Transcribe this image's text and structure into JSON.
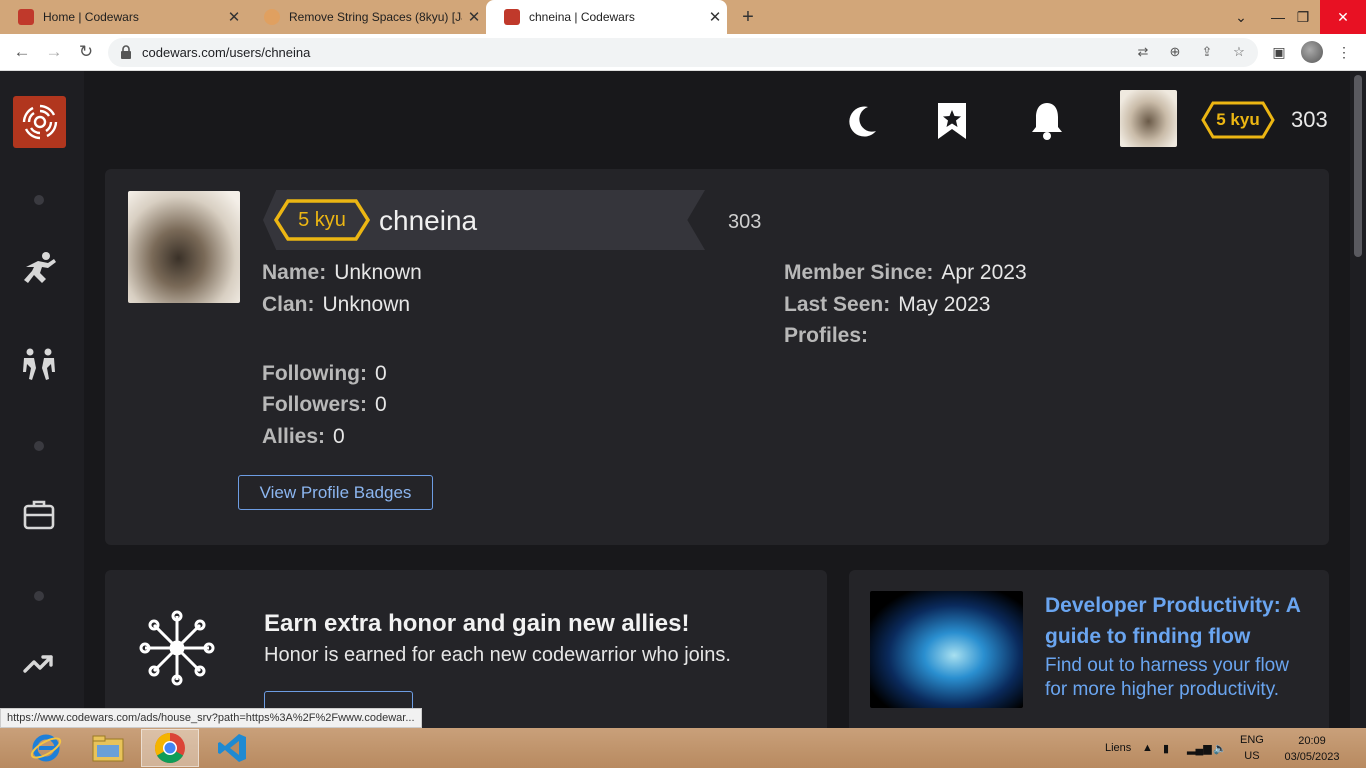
{
  "tabs": [
    {
      "title": "Home | Codewars",
      "favicon_color": "#c0392b"
    },
    {
      "title": "Remove String Spaces (8kyu) [Jav",
      "favicon_color": "#e0a060"
    },
    {
      "title": "chneina | Codewars",
      "favicon_color": "#c0392b"
    }
  ],
  "browser": {
    "url": "codewars.com/users/chneina",
    "new_tab": "+",
    "close_tab": "✕",
    "status_url": "https://www.codewars.com/ads/house_srv?path=https%3A%2F%2Fwww.codewar..."
  },
  "header": {
    "rank": "5 kyu",
    "honor": "303"
  },
  "profile": {
    "rank": "5 kyu",
    "username": "chneina",
    "honor": "303",
    "left_fields": [
      {
        "label": "Name:",
        "value": "Unknown"
      },
      {
        "label": "Clan:",
        "value": "Unknown"
      }
    ],
    "social_fields": [
      {
        "label": "Following:",
        "value": "0"
      },
      {
        "label": "Followers:",
        "value": "0"
      },
      {
        "label": "Allies:",
        "value": "0"
      }
    ],
    "right_fields": [
      {
        "label": "Member Since:",
        "value": "Apr 2023"
      },
      {
        "label": "Last Seen:",
        "value": "May 2023"
      },
      {
        "label": "Profiles:",
        "value": ""
      }
    ],
    "badges_button": "View Profile Badges"
  },
  "promo": {
    "title": "Earn extra honor and gain new allies!",
    "subtitle": "Honor is earned for each new codewarrior who joins."
  },
  "ad": {
    "title": "Developer Productivity: A guide to finding flow",
    "description": "Find out to harness your flow for more higher productivity."
  },
  "taskbar": {
    "links": "Liens",
    "lang_line1": "ENG",
    "lang_line2": "US",
    "time": "20:09",
    "date": "03/05/2023"
  },
  "colors": {
    "accent_rank": "#ecb613",
    "link_blue": "#6aa5f0",
    "logo_red": "#b1361e"
  }
}
